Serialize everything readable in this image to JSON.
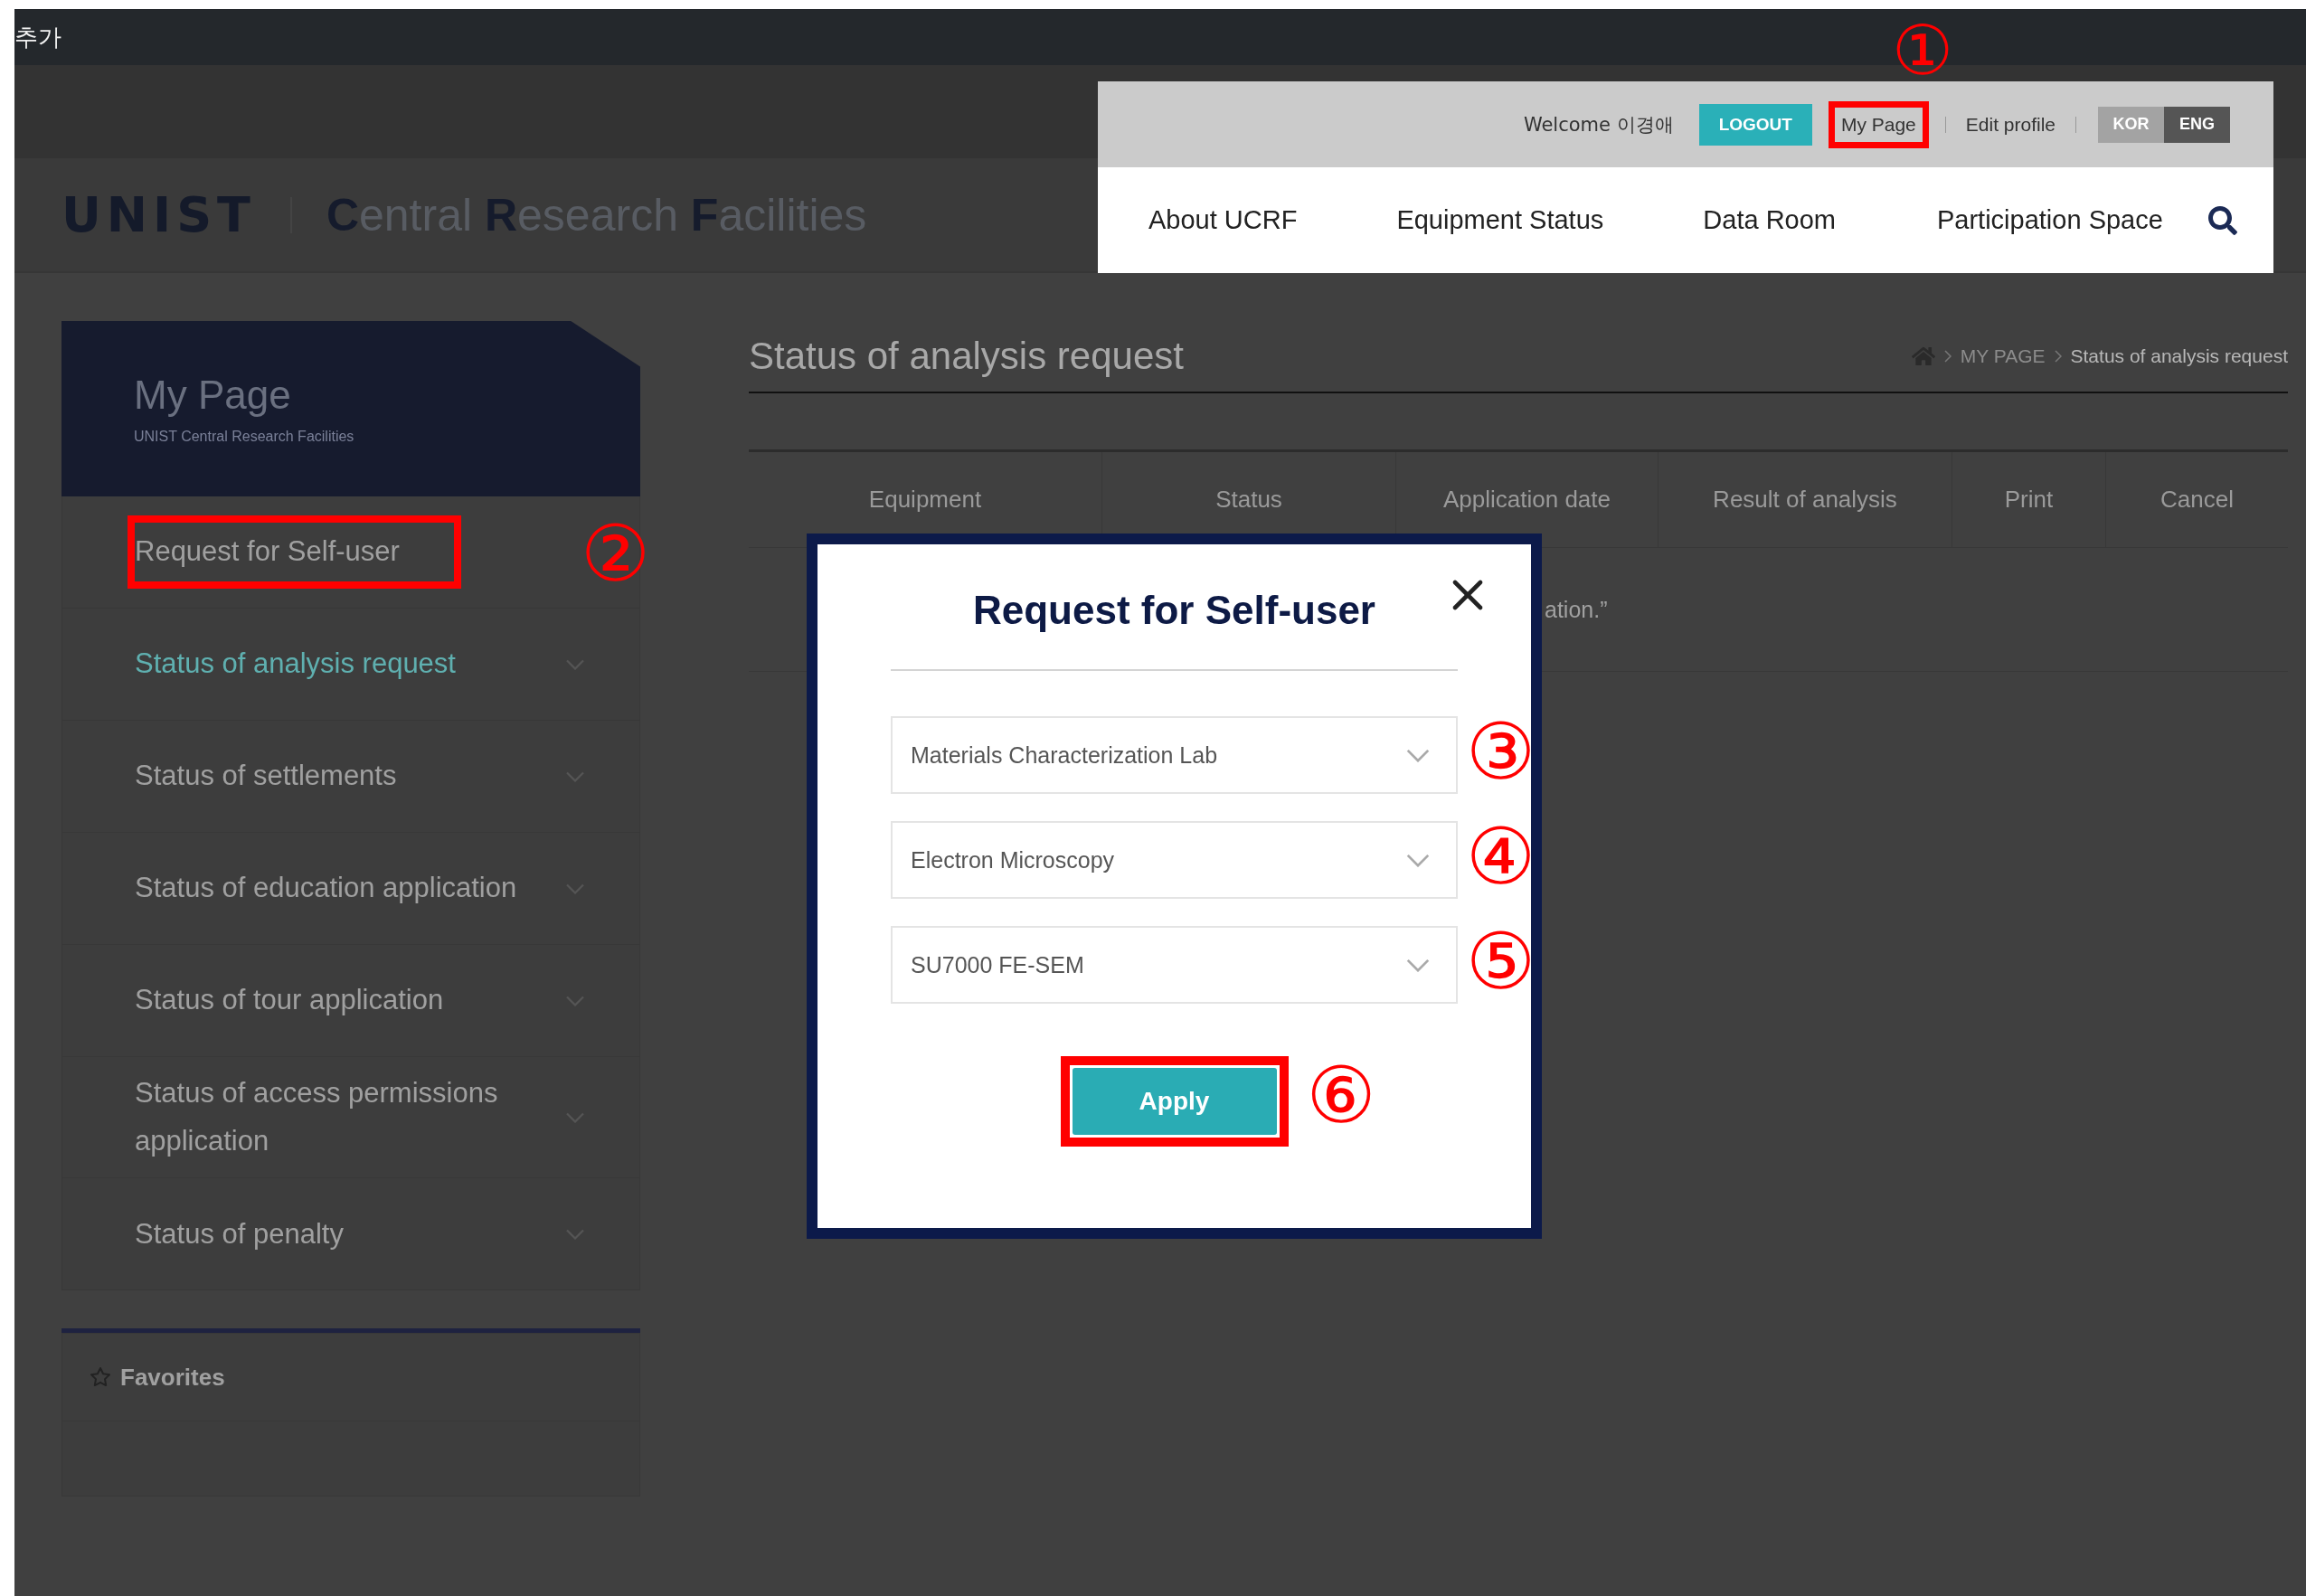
{
  "top_bar": {
    "title": "추가"
  },
  "header": {
    "logo": "UNIST",
    "site_title": "**C**entral **R**esearch **F**acilities"
  },
  "user_bar": {
    "welcome": "Welcome 이경애",
    "logout": "LOGOUT",
    "links": [
      {
        "label": "My Page",
        "marked": true,
        "callout": "①"
      },
      {
        "label": "Edit profile",
        "marked": false
      }
    ],
    "languages": [
      {
        "label": "KOR",
        "selected": false
      },
      {
        "label": "ENG",
        "selected": true
      }
    ]
  },
  "nav": {
    "items": [
      "About UCRF",
      "Equipment Status",
      "Data Room",
      "Participation Space"
    ]
  },
  "sidebar": {
    "title": "My Page",
    "subtitle": "UNIST Central Research Facilities",
    "items": [
      {
        "label": "Request for Self-user",
        "selected": false,
        "has_submenu": false,
        "marked": true,
        "callout": "②"
      },
      {
        "label": "Status of analysis request",
        "selected": true,
        "has_submenu": true,
        "marked": false
      },
      {
        "label": "Status of settlements",
        "selected": false,
        "has_submenu": true,
        "marked": false
      },
      {
        "label": "Status of education application",
        "selected": false,
        "has_submenu": true,
        "marked": false
      },
      {
        "label": "Status of tour application",
        "selected": false,
        "has_submenu": true,
        "marked": false
      },
      {
        "label": "Status of access permissions application",
        "selected": false,
        "has_submenu": true,
        "marked": false
      },
      {
        "label": "Status of penalty",
        "selected": false,
        "has_submenu": true,
        "marked": false
      }
    ],
    "favorites": "Favorites"
  },
  "main": {
    "title": "Status of analysis request",
    "breadcrumb": [
      "MY PAGE",
      "Status of analysis request"
    ],
    "table": {
      "columns": [
        "Equipment",
        "Status",
        "Application date",
        "Result of analysis",
        "Print",
        "Cancel"
      ],
      "empty_message": "ation.”"
    }
  },
  "modal": {
    "title": "Request for Self-user",
    "selects": [
      {
        "value": "Materials Characterization Lab",
        "callout": "③"
      },
      {
        "value": "Electron Microscopy",
        "callout": "④"
      },
      {
        "value": "SU7000 FE-SEM",
        "callout": "⑤"
      }
    ],
    "apply": {
      "label": "Apply",
      "marked": true,
      "callout": "⑥"
    }
  }
}
